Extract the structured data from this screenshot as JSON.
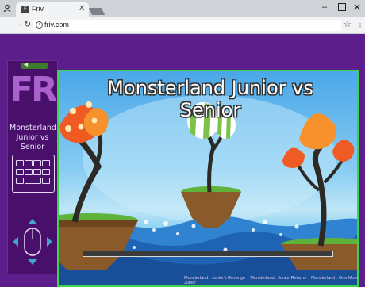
{
  "browser": {
    "tab_title": "Friv",
    "tab_favicon": "F",
    "url": "friv.com",
    "icons": [
      "user-icon",
      "close-icon",
      "new-tab-icon",
      "minimize-icon",
      "maximize-icon",
      "window-close-icon",
      "back-icon",
      "forward-icon",
      "reload-icon",
      "info-icon",
      "star-icon",
      "menu-icon"
    ]
  },
  "sidebar": {
    "game_title": "Monsterland Junior vs Senior",
    "logo": "FRIV",
    "icons": [
      "back-arrow-icon",
      "keyboard-icon",
      "dpad-icon",
      "mouse-icon"
    ]
  },
  "game": {
    "title": "Monsterland Junior vs Senior"
  },
  "footer": {
    "links": [
      "Monsterland : Junior's Revenge",
      "Monsterland : Junior Returns",
      "Monsterland : One More Junior"
    ]
  },
  "colors": {
    "page_bg": "#5b1e8a",
    "sidebar_bg": "#48106b",
    "game_border": "#3fd24c",
    "sky": "#4aa7e8"
  }
}
